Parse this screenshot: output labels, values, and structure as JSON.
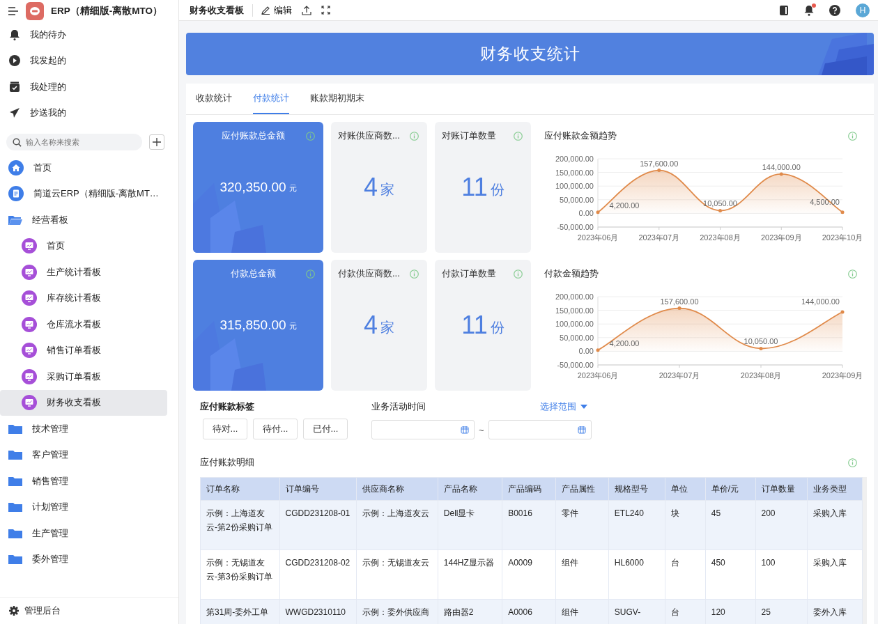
{
  "sidebar": {
    "app_title": "ERP（精细版-离散MTO）",
    "nav": [
      {
        "label": "我的待办",
        "kind": "bell"
      },
      {
        "label": "我发起的",
        "kind": "play"
      },
      {
        "label": "我处理的",
        "kind": "check"
      },
      {
        "label": "抄送我的",
        "kind": "send"
      }
    ],
    "search": {
      "placeholder": "输入名称来搜索"
    },
    "tree": [
      {
        "label": "首页",
        "kind": "home",
        "selected": false
      },
      {
        "label": "简道云ERP（精细版-离散MT…",
        "kind": "app",
        "selected": false
      },
      {
        "label": "经营看板",
        "kind": "folder",
        "selected": false,
        "expanded": true,
        "children": [
          {
            "label": "首页",
            "selected": false
          },
          {
            "label": "生产统计看板",
            "selected": false
          },
          {
            "label": "库存统计看板",
            "selected": false
          },
          {
            "label": "仓库流水看板",
            "selected": false
          },
          {
            "label": "销售订单看板",
            "selected": false
          },
          {
            "label": "采购订单看板",
            "selected": false
          },
          {
            "label": "财务收支看板",
            "selected": true
          }
        ]
      },
      {
        "label": "技术管理",
        "kind": "folder",
        "selected": false,
        "expanded": false
      },
      {
        "label": "客户管理",
        "kind": "folder",
        "selected": false,
        "expanded": false
      },
      {
        "label": "销售管理",
        "kind": "folder",
        "selected": false,
        "expanded": false
      },
      {
        "label": "计划管理",
        "kind": "folder",
        "selected": false,
        "expanded": false
      },
      {
        "label": "生产管理",
        "kind": "folder",
        "selected": false,
        "expanded": false
      },
      {
        "label": "委外管理",
        "kind": "folder",
        "selected": false,
        "expanded": false
      }
    ],
    "footer": "管理后台"
  },
  "topbar": {
    "title": "财务收支看板",
    "edit": "编辑",
    "avatar": "H",
    "notification": true
  },
  "banner": {
    "title": "财务收支统计"
  },
  "tabs": [
    {
      "label": "收款统计",
      "selected": false
    },
    {
      "label": "付款统计",
      "selected": true
    },
    {
      "label": "账款期初期末",
      "selected": false
    }
  ],
  "card_rows": [
    {
      "cards": [
        {
          "kind": "amount",
          "title": "应付账款总金额",
          "value": "320,350.00",
          "unit": "元"
        },
        {
          "kind": "count",
          "title": "对账供应商数...",
          "value": "4",
          "unit": "家"
        },
        {
          "kind": "count",
          "title": "对账订单数量",
          "value": "11",
          "unit": "份"
        }
      ],
      "chart": {
        "title": "应付账款金额趋势",
        "chart_data": {
          "type": "area",
          "categories": [
            "2023年06月",
            "2023年07月",
            "2023年08月",
            "2023年09月",
            "2023年10月"
          ],
          "series": [
            {
              "color": "#e08a4a",
              "values": [
                4200,
                157600,
                10050,
                144000,
                4500
              ]
            }
          ],
          "grid": true,
          "ylim": [
            -50000,
            200000
          ],
          "yticks": [
            {
              "value": 200000,
              "label": "200,000.00"
            },
            {
              "value": 150000,
              "label": "150,000.00"
            },
            {
              "value": 100000,
              "label": "100,000.00"
            },
            {
              "value": 50000,
              "label": "50,000.00"
            },
            {
              "value": 0,
              "label": "0.00"
            },
            {
              "value": -50000,
              "label": "-50,000.00"
            }
          ],
          "value_labels": [
            "4,200.00",
            "157,600.00",
            "10,050.00",
            "144,000.00",
            "4,500.00"
          ]
        }
      }
    },
    {
      "cards": [
        {
          "kind": "amount",
          "title": "付款总金额",
          "value": "315,850.00",
          "unit": "元"
        },
        {
          "kind": "count",
          "title": "付款供应商数...",
          "value": "4",
          "unit": "家"
        },
        {
          "kind": "count",
          "title": "付款订单数量",
          "value": "11",
          "unit": "份"
        }
      ],
      "chart": {
        "title": "付款金额趋势",
        "chart_data": {
          "type": "area",
          "categories": [
            "2023年06月",
            "2023年07月",
            "2023年08月",
            "2023年09月"
          ],
          "series": [
            {
              "color": "#e08a4a",
              "values": [
                4200,
                157600,
                10050,
                144000
              ]
            }
          ],
          "grid": true,
          "ylim": [
            -50000,
            200000
          ],
          "yticks": [
            {
              "value": 200000,
              "label": "200,000.00"
            },
            {
              "value": 150000,
              "label": "150,000.00"
            },
            {
              "value": 100000,
              "label": "100,000.00"
            },
            {
              "value": 50000,
              "label": "50,000.00"
            },
            {
              "value": 0,
              "label": "0.00"
            },
            {
              "value": -50000,
              "label": "-50,000.00"
            }
          ],
          "value_labels": [
            "4,200.00",
            "157,600.00",
            "10,050.00",
            "144,000.00"
          ]
        }
      }
    }
  ],
  "filters": {
    "tag_label": "应付账款标签",
    "tags": [
      "待对...",
      "待付...",
      "已付..."
    ],
    "date_label": "业务活动时间",
    "range_link": "选择范围",
    "separator": "~"
  },
  "table": {
    "title": "应付账款明细",
    "columns": [
      "订单名称",
      "订单编号",
      "供应商名称",
      "产品名称",
      "产品编码",
      "产品属性",
      "规格型号",
      "单位",
      "单价/元",
      "订单数量",
      "业务类型"
    ],
    "rows": [
      [
        "示例：上海道友云-第2份采购订单",
        "CGDD231208-01",
        "示例：上海道友云",
        "Dell显卡",
        "B0016",
        "零件",
        "ETL240",
        "块",
        "45",
        "200",
        "采购入库"
      ],
      [
        "示例：无锡道友云-第3份采购订单",
        "CGDD231208-02",
        "示例：无锡道友云",
        "144HZ显示器",
        "A0009",
        "组件",
        "HL6000",
        "台",
        "450",
        "100",
        "采购入库"
      ],
      [
        "第31周-委外工单",
        "WWGD2310110",
        "示例：委外供应商",
        "路由器2",
        "A0006",
        "组件",
        "SUGV-",
        "台",
        "120",
        "25",
        "委外入库"
      ]
    ]
  }
}
